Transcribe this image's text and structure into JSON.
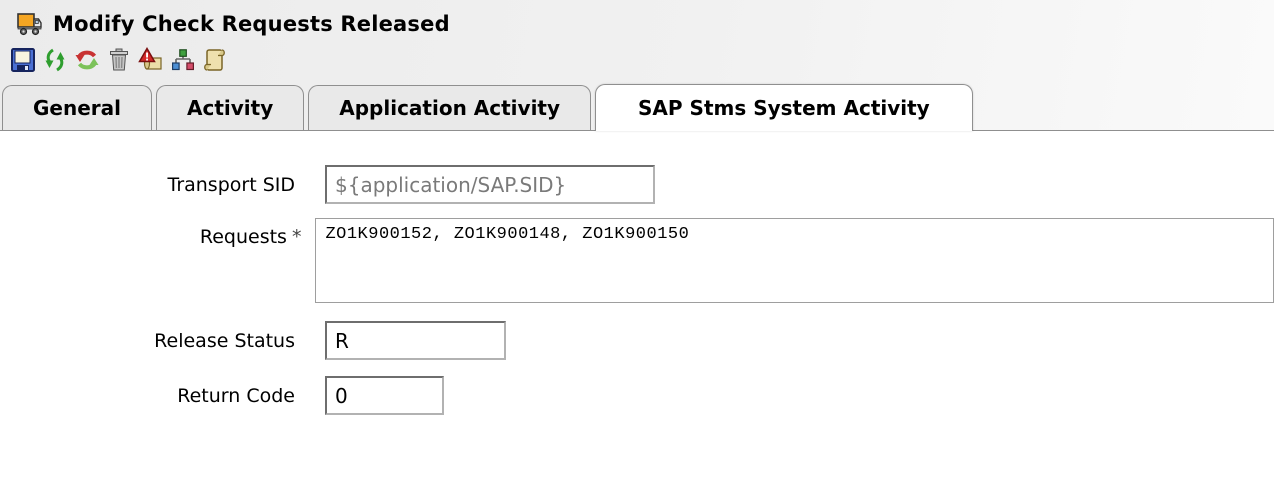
{
  "window": {
    "title": "Modify Check Requests Released"
  },
  "toolbar": {
    "buttons": [
      {
        "name": "save",
        "icon": "save-icon"
      },
      {
        "name": "sync",
        "icon": "sync-arrows-icon"
      },
      {
        "name": "refresh",
        "icon": "refresh-circle-icon"
      },
      {
        "name": "delete",
        "icon": "trash-icon"
      },
      {
        "name": "alert-log",
        "icon": "alert-scroll-icon"
      },
      {
        "name": "hierarchy",
        "icon": "hierarchy-icon"
      },
      {
        "name": "script",
        "icon": "script-scroll-icon"
      }
    ]
  },
  "tabs": [
    {
      "label": "General",
      "active": false
    },
    {
      "label": "Activity",
      "active": false
    },
    {
      "label": "Application Activity",
      "active": false
    },
    {
      "label": "SAP Stms System Activity",
      "active": true
    }
  ],
  "form": {
    "required_marker": "*",
    "fields": [
      {
        "label": "Transport SID",
        "value": "${application/SAP.SID}",
        "state": "readonly"
      },
      {
        "label": "Requests",
        "value": "ZO1K900152, ZO1K900148, ZO1K900150",
        "required": true
      },
      {
        "label": "Release Status",
        "value": "R"
      },
      {
        "label": "Return Code",
        "value": "0"
      }
    ]
  },
  "colors": {
    "header_bg": "#efefef",
    "tab_inactive_bg": "#e9e9e9",
    "tab_active_bg": "#ffffff",
    "tab_border": "#8f8f8f",
    "input_border_dark": "#6e6e6e",
    "input_border_light": "#b2b2b2",
    "readonly_text": "#7a7a7a",
    "truck_orange": "#f5a623",
    "icon_green": "#2f9e2f",
    "icon_red": "#c83232"
  }
}
